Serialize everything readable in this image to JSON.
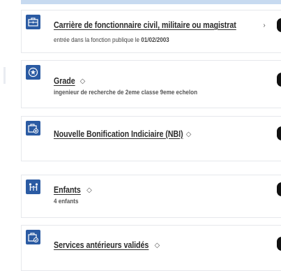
{
  "cards": [
    {
      "icon": "briefcase-icon",
      "title": "Carrière de fonctionnaire civil, militaire ou magistrat",
      "chevron": "›",
      "subtitle_prefix": "entrée dans la fonction publique le ",
      "subtitle_date": "01/02/2003"
    },
    {
      "icon": "star-circle-icon",
      "title": "Grade",
      "chevron": "◇",
      "subtitle": "ingenieur de recherche de 2eme classe 9eme echelon"
    },
    {
      "icon": "briefcase-plus-icon",
      "title": "Nouvelle Bonification Indiciaire (NBI)",
      "chevron": "◇"
    },
    {
      "icon": "family-icon",
      "title": "Enfants",
      "chevron": "◇",
      "subtitle": "4 enfants"
    },
    {
      "icon": "briefcase-check-icon",
      "title": "Services antérieurs validés",
      "chevron": "◇"
    }
  ],
  "colors": {
    "icon_bg": "#2b5ba3",
    "top_strip": "#c7daf0",
    "card_border": "#e6e8ec"
  }
}
